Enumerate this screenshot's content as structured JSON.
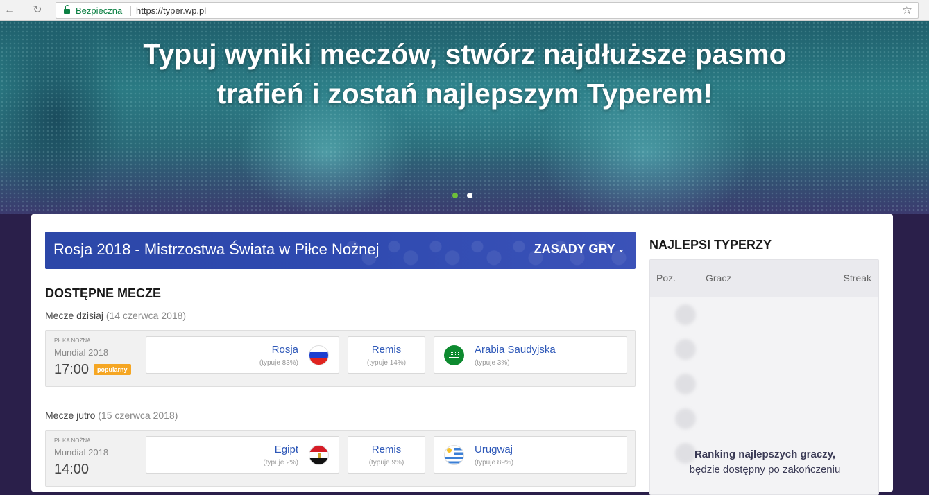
{
  "browser": {
    "back_icon": "←",
    "reload_icon": "↻",
    "secure_label": "Bezpieczna",
    "url": "https://typer.wp.pl",
    "star_icon": "☆"
  },
  "hero": {
    "title": "Typuj wyniki meczów, stwórz najdłuższe pasmo trafień i zostań najlepszym Typerem!",
    "slides_count": 2,
    "active_slide": 1,
    "active_dot_color": "#6ebf3a"
  },
  "tournament": {
    "title": "Rosja 2018 - Mistrzostwa Świata w Piłce Nożnej",
    "rules_label": "ZASADY GRY",
    "rules_icon": "⌄"
  },
  "matches_section": {
    "title": "DOSTĘPNE MECZE",
    "days": [
      {
        "label": "Mecze dzisiaj",
        "date": "(14 czerwca 2018)",
        "matches": [
          {
            "sport": "PIŁKA NOŻNA",
            "league": "Mundial 2018",
            "time": "17:00",
            "badge": "popularny",
            "home": {
              "name": "Rosja",
              "pct": "(typuje 83%)",
              "flag": "russia-flag-icon"
            },
            "draw": {
              "name": "Remis",
              "pct": "(typuje 14%)"
            },
            "away": {
              "name": "Arabia Saudyjska",
              "pct": "(typuje 3%)",
              "flag": "saudi-arabia-flag-icon"
            }
          }
        ]
      },
      {
        "label": "Mecze jutro",
        "date": "(15 czerwca 2018)",
        "matches": [
          {
            "sport": "PIŁKA NOŻNA",
            "league": "Mundial 2018",
            "time": "14:00",
            "home": {
              "name": "Egipt",
              "pct": "(typuje 2%)",
              "flag": "egypt-flag-icon"
            },
            "draw": {
              "name": "Remis",
              "pct": "(typuje 9%)"
            },
            "away": {
              "name": "Urugwaj",
              "pct": "(typuje 89%)",
              "flag": "uruguay-flag-icon"
            }
          }
        ]
      }
    ]
  },
  "leaderboard": {
    "title": "NAJLEPSI TYPERZY",
    "columns": [
      "Poz.",
      "Gracz",
      "Streak"
    ],
    "overlay_bold": "Ranking najlepszych graczy,",
    "overlay_text": "będzie dostępny po zakończeniu"
  },
  "colors": {
    "banner_blue": "#2f4ab0",
    "link_blue": "#2e58b8",
    "badge_orange": "#f5a623",
    "secure_green": "#0b8043"
  }
}
